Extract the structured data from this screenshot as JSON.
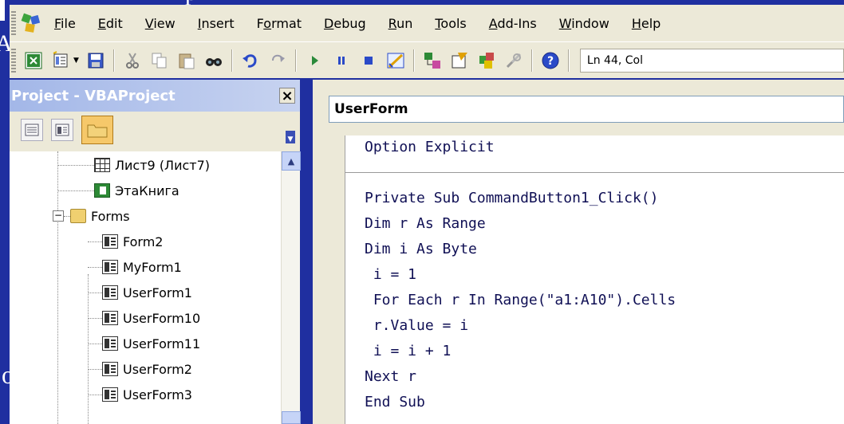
{
  "background_fragments": {
    "top": "р",
    "left": "АИ",
    "left_bottom": "о"
  },
  "menubar": {
    "items": [
      {
        "label": "File",
        "key": "F"
      },
      {
        "label": "Edit",
        "key": "E"
      },
      {
        "label": "View",
        "key": "V"
      },
      {
        "label": "Insert",
        "key": "I"
      },
      {
        "label": "Format",
        "key": "o"
      },
      {
        "label": "Debug",
        "key": "D"
      },
      {
        "label": "Run",
        "key": "R"
      },
      {
        "label": "Tools",
        "key": "T"
      },
      {
        "label": "Add-Ins",
        "key": "A"
      },
      {
        "label": "Window",
        "key": "W"
      },
      {
        "label": "Help",
        "key": "H"
      }
    ]
  },
  "toolbar": {
    "status": "Ln 44, Col",
    "icons": [
      "view-excel-icon",
      "insert-userform-icon",
      "save-icon",
      "cut-icon",
      "copy-icon",
      "paste-icon",
      "find-icon",
      "undo-icon",
      "redo-icon",
      "run-icon",
      "break-icon",
      "reset-icon",
      "design-mode-icon",
      "project-explorer-icon",
      "properties-icon",
      "object-browser-icon",
      "toolbox-icon",
      "help-icon"
    ]
  },
  "project": {
    "title": "Project - VBAProject",
    "close_label": "×",
    "tree": [
      {
        "label": "Лист9 (Лист7)",
        "icon": "sheet-icon"
      },
      {
        "label": "ЭтаКнига",
        "icon": "workbook-icon"
      },
      {
        "label": "Forms",
        "icon": "folder-icon",
        "expander": "−"
      },
      {
        "label": "Form2",
        "icon": "form-icon"
      },
      {
        "label": "MyForm1",
        "icon": "form-icon"
      },
      {
        "label": "UserForm1",
        "icon": "form-icon"
      },
      {
        "label": "UserForm10",
        "icon": "form-icon"
      },
      {
        "label": "UserForm11",
        "icon": "form-icon"
      },
      {
        "label": "UserForm2",
        "icon": "form-icon"
      },
      {
        "label": "UserForm3",
        "icon": "form-icon"
      }
    ]
  },
  "code": {
    "object_dropdown": "UserForm",
    "lines": [
      "Option Explicit",
      "",
      "Private Sub CommandButton1_Click()",
      "Dim r As Range",
      "Dim i As Byte",
      " i = 1",
      " For Each r In Range(\"a1:A10\").Cells",
      " r.Value = i",
      " i = i + 1",
      "Next r",
      "End Sub"
    ]
  },
  "colors": {
    "slide_background": "#1f2fa0",
    "chrome": "#ece9d8",
    "code_text": "#101055"
  }
}
